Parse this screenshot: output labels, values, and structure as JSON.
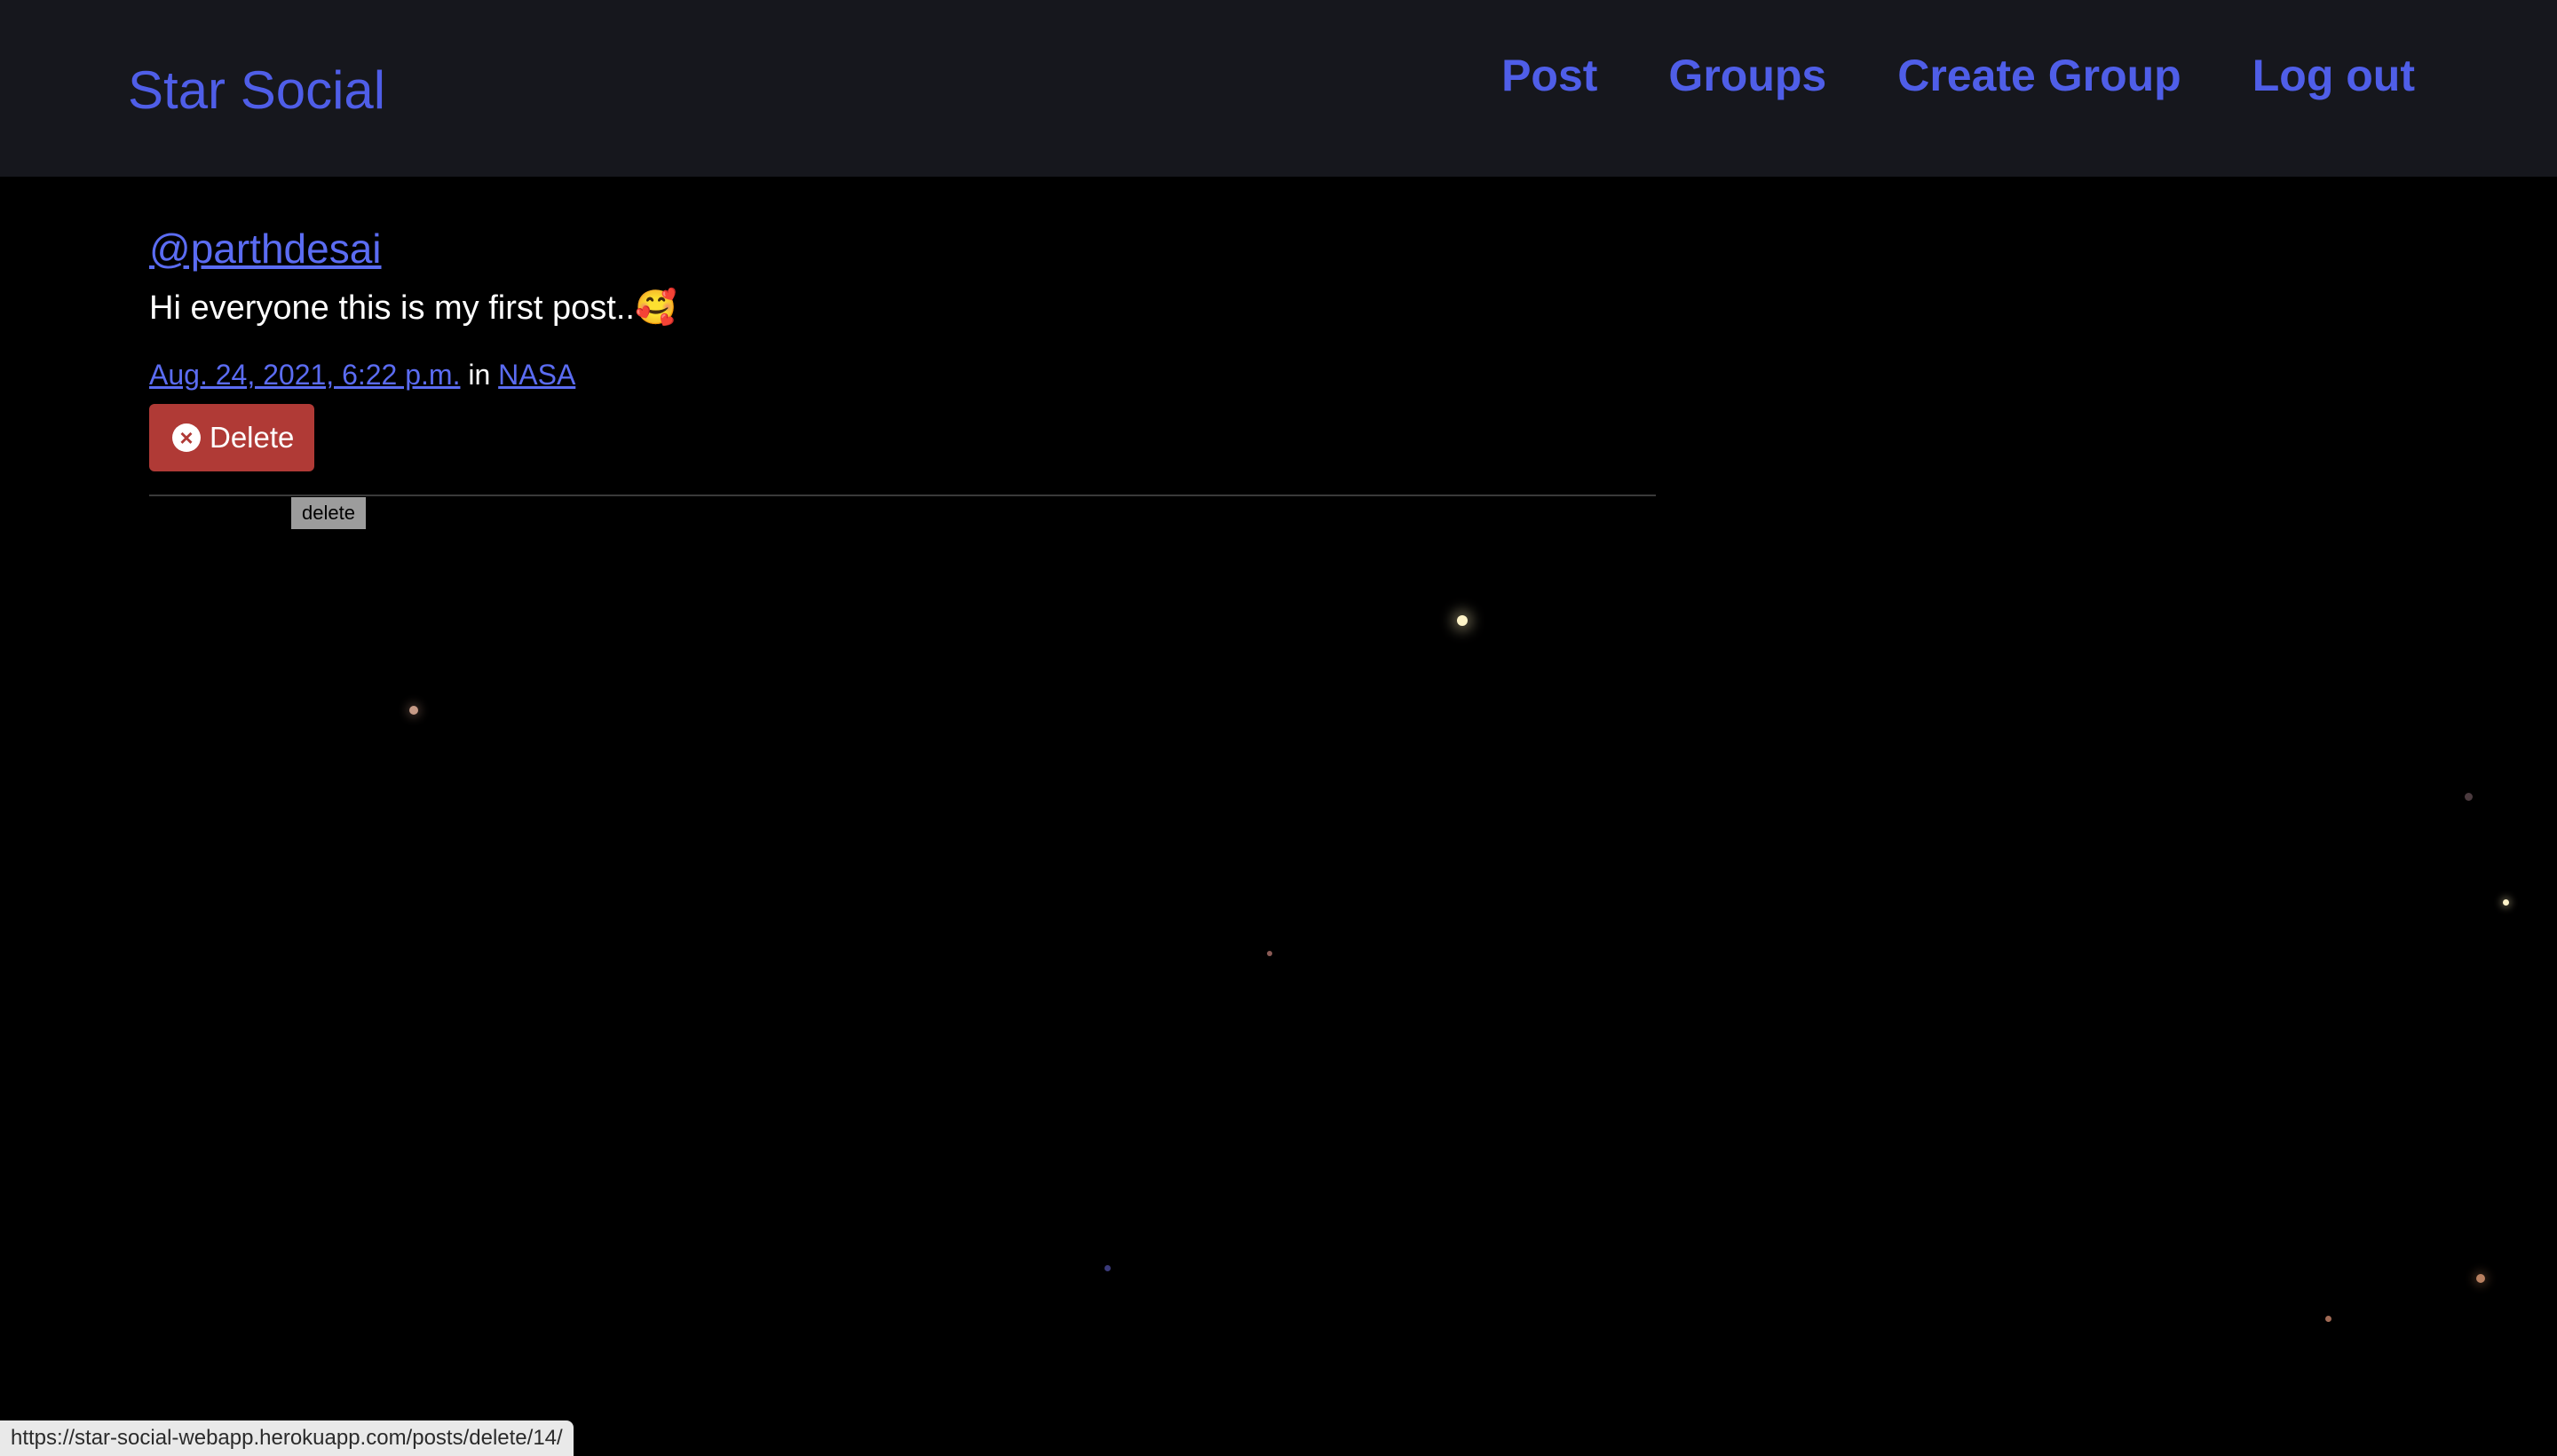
{
  "navbar": {
    "brand": "Star Social",
    "links": [
      "Post",
      "Groups",
      "Create Group",
      "Log out"
    ],
    "link_color": "#4f5ee8",
    "background": "#16171d"
  },
  "post": {
    "author": "@parthdesai",
    "message": "Hi everyone this is my first post..",
    "emoji": "🥰",
    "timestamp": "Aug. 24, 2021, 6:22 p.m.",
    "in_label": "in",
    "group": "NASA",
    "delete_label": "Delete",
    "delete_icon": "x-circle-icon",
    "delete_color": "#b03a36"
  },
  "tooltip": {
    "text": "delete"
  },
  "status_bar": {
    "url": "https://star-social-webapp.herokuapp.com/posts/delete/14/"
  }
}
